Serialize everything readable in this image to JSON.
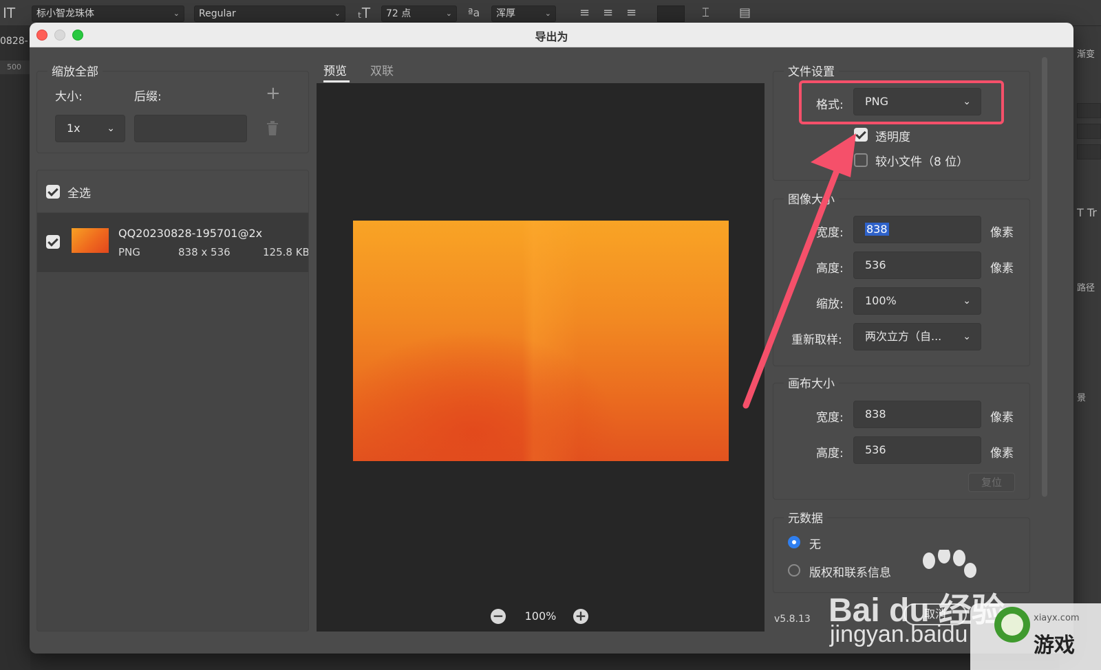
{
  "toolbar": {
    "font_family": "标小智龙珠体",
    "font_style": "Regular",
    "font_size": "72 点",
    "antialias": "浑厚"
  },
  "background": {
    "left_fragment": "0828-",
    "ruler_value": "500",
    "right_fragments": {
      "gradient": "渐变",
      "path": "路径",
      "background": "景"
    }
  },
  "dialog": {
    "title": "导出为",
    "scale_all": {
      "legend": "缩放全部",
      "size_label": "大小:",
      "suffix_label": "后缀:",
      "size_value": "1x",
      "suffix_value": ""
    },
    "list": {
      "select_all": "全选",
      "assets": [
        {
          "name": "QQ20230828-195701@2x",
          "format": "PNG",
          "dimensions": "838 x 536",
          "filesize": "125.8 KB",
          "checked": true
        }
      ]
    },
    "tabs": [
      {
        "label": "预览",
        "active": true
      },
      {
        "label": "双联",
        "active": false
      }
    ],
    "zoom": "100%",
    "file_settings": {
      "legend": "文件设置",
      "format_label": "格式:",
      "format_value": "PNG",
      "transparency_label": "透明度",
      "transparency_checked": true,
      "smaller_file_label": "较小文件（8 位）",
      "smaller_file_checked": false
    },
    "image_size": {
      "legend": "图像大小",
      "width_label": "宽度:",
      "width_value": "838",
      "height_label": "高度:",
      "height_value": "536",
      "scale_label": "缩放:",
      "scale_value": "100%",
      "resample_label": "重新取样:",
      "resample_value": "两次立方（自...",
      "unit": "像素"
    },
    "canvas_size": {
      "legend": "画布大小",
      "width_label": "宽度:",
      "width_value": "838",
      "height_label": "高度:",
      "height_value": "536",
      "unit": "像素",
      "reset_label": "复位"
    },
    "metadata": {
      "legend": "元数据",
      "option_none": "无",
      "option_copyright": "版权和联系信息",
      "selected": "无"
    },
    "version": "v5.8.13",
    "cancel_label": "取消"
  },
  "watermarks": {
    "baidu_logo": "Bai du 经验",
    "baidu_url": "jingyan.baidu",
    "corner_url": "xiayx.com",
    "corner_text": "游戏"
  },
  "colors": {
    "highlight": "#f5506a",
    "accent_blue": "#2f7ff0",
    "dialog_bg": "#4b4b4b"
  }
}
